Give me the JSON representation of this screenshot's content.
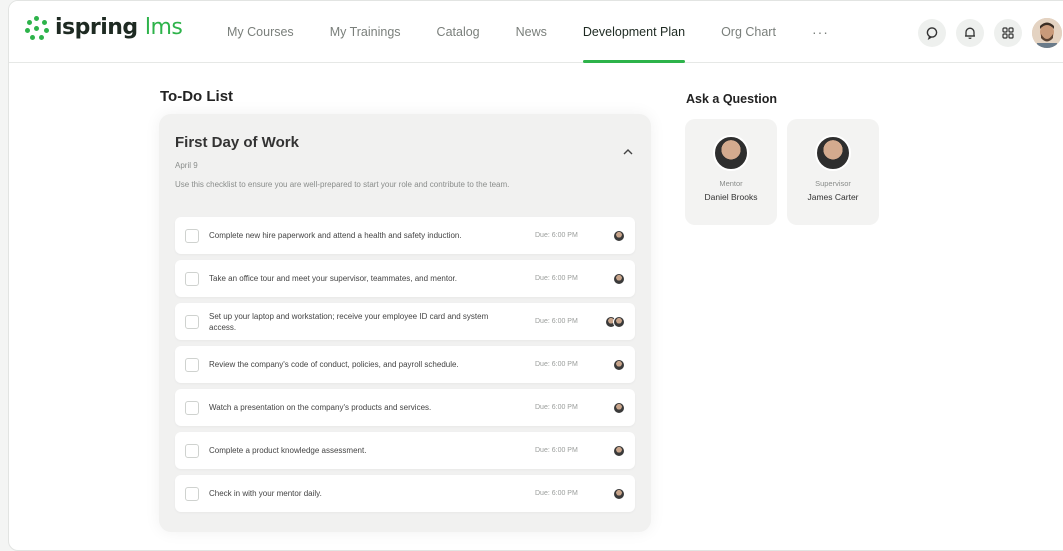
{
  "app": {
    "logo_main": "ispring",
    "logo_suffix": "lms",
    "brand_color": "#2db34a"
  },
  "nav": {
    "items": [
      {
        "label": "My Courses"
      },
      {
        "label": "My Trainings"
      },
      {
        "label": "Catalog"
      },
      {
        "label": "News"
      },
      {
        "label": "Development Plan",
        "active": true
      },
      {
        "label": "Org Chart"
      }
    ],
    "more_label": "···"
  },
  "tools": {
    "search_icon": "search-icon",
    "notifications_icon": "bell-icon",
    "apps_icon": "grid-icon"
  },
  "todo": {
    "title": "To-Do List",
    "card": {
      "title": "First Day of Work",
      "date": "April 9",
      "description": "Use this checklist to ensure you are well-prepared to start your role and contribute to the team.",
      "tasks": [
        {
          "text": "Complete new hire paperwork and attend a health and safety induction.",
          "due": "Due: 6:00 PM",
          "assignees": 1
        },
        {
          "text": "Take an office tour and meet your supervisor, teammates, and mentor.",
          "due": "Due: 6:00 PM",
          "assignees": 1
        },
        {
          "text": "Set up your laptop and workstation; receive your employee ID card and system access.",
          "due": "Due: 6:00 PM",
          "assignees": 2
        },
        {
          "text": "Review the company's code of conduct, policies, and payroll schedule.",
          "due": "Due: 6:00 PM",
          "assignees": 1
        },
        {
          "text": "Watch a presentation on the company's products and services.",
          "due": "Due: 6:00 PM",
          "assignees": 1
        },
        {
          "text": "Complete a product knowledge assessment.",
          "due": "Due: 6:00 PM",
          "assignees": 1
        },
        {
          "text": "Check in with your mentor daily.",
          "due": "Due: 6:00 PM",
          "assignees": 1
        }
      ]
    }
  },
  "ask": {
    "title": "Ask a Question",
    "people": [
      {
        "role": "Mentor",
        "name": "Daniel Brooks"
      },
      {
        "role": "Supervisor",
        "name": "James Carter"
      }
    ]
  }
}
